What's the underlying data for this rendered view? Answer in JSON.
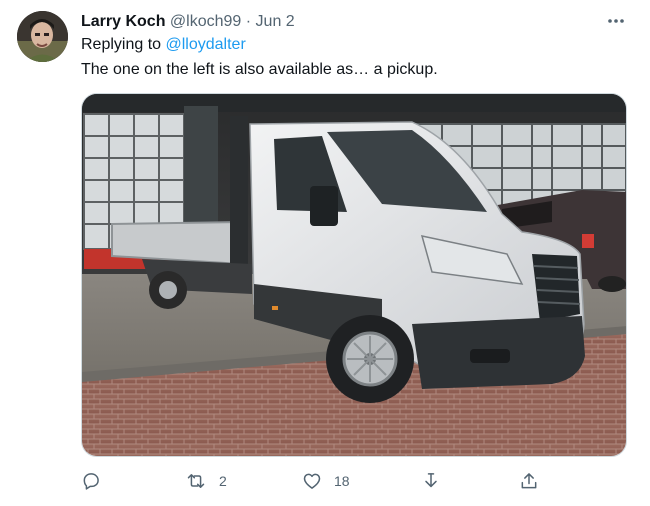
{
  "author": {
    "name": "Larry Koch",
    "handle": "@lkoch99",
    "separator": "·",
    "date": "Jun 2"
  },
  "reply": {
    "prefix": "Replying to",
    "mention": "@lloydalter"
  },
  "tweet": {
    "text": "The one on the left is also available as… a pickup."
  },
  "media": {
    "subject": "white-dropside-pickup-van-photo"
  },
  "actions": {
    "reply_icon": "reply-icon",
    "retweet_icon": "retweet-icon",
    "retweet_count": "2",
    "like_icon": "heart-icon",
    "like_count": "18",
    "download_icon": "download-icon",
    "share_icon": "share-icon"
  },
  "colors": {
    "link": "#1d9bf0",
    "secondary_text": "#536471",
    "primary_text": "#0f1419"
  }
}
